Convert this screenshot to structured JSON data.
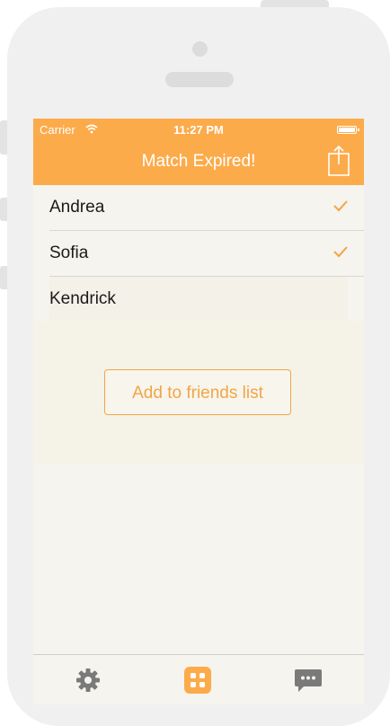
{
  "status_bar": {
    "carrier": "Carrier",
    "time": "11:27 PM"
  },
  "nav": {
    "title": "Match Expired!",
    "share_icon": "share-icon"
  },
  "players": [
    {
      "name": "Andrea",
      "checked": true
    },
    {
      "name": "Sofia",
      "checked": true
    },
    {
      "name": "Kendrick",
      "checked": false
    }
  ],
  "actions": {
    "add_friends_label": "Add to friends list"
  },
  "tabbar": {
    "items": [
      {
        "icon": "gear-icon",
        "active": false
      },
      {
        "icon": "dice-icon",
        "active": true
      },
      {
        "icon": "chat-bubble-icon",
        "active": false
      }
    ]
  },
  "colors": {
    "accent": "#fcab4b",
    "button_text": "#f2a546",
    "background": "#f5f4ee",
    "inactive_icon": "#7a7a7a"
  }
}
